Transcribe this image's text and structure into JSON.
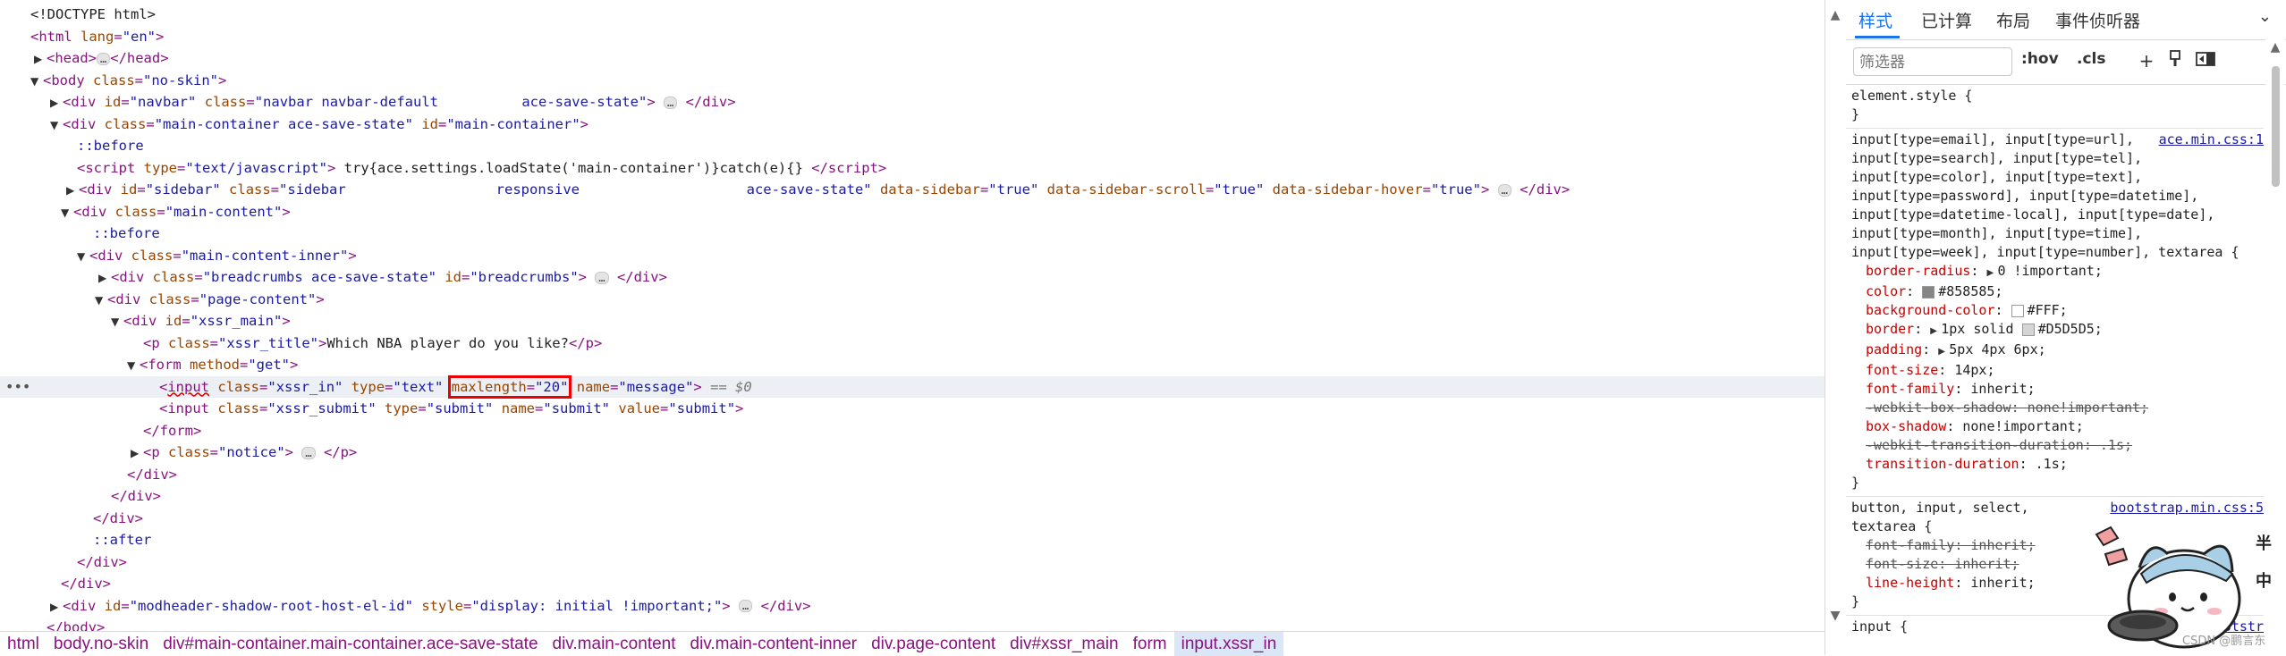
{
  "tree": {
    "doctype": "<!DOCTYPE html>",
    "html_open": [
      "html",
      "lang",
      "\"en\""
    ],
    "head": "head",
    "body_class": "\"no-skin\"",
    "navbar_id": "\"navbar\"",
    "navbar_class": "\"navbar navbar-default          ace-save-state\"",
    "main_container_class": "\"main-container ace-save-state\"",
    "main_container_id": "\"main-container\"",
    "before": "::before",
    "after": "::after",
    "script_type": "\"text/javascript\"",
    "script_text": "try{ace.settings.loadState('main-container')}catch(e){}",
    "sidebar_id": "\"sidebar\"",
    "sidebar_class": "\"sidebar                  responsive                    ace-save-state\"",
    "sidebar_data_sidebar": "\"true\"",
    "sidebar_data_scroll": "\"true\"",
    "sidebar_data_hover": "\"true\"",
    "main_content_class": "\"main-content\"",
    "main_content_inner_class": "\"main-content-inner\"",
    "breadcrumbs_class": "\"breadcrumbs ace-save-state\"",
    "breadcrumbs_id": "\"breadcrumbs\"",
    "page_content_class": "\"page-content\"",
    "xssr_main_id": "\"xssr_main\"",
    "p_title_class": "\"xssr_title\"",
    "p_title_text": "Which NBA player do you like?",
    "form_method": "\"get\"",
    "input1_class": "\"xssr_in\"",
    "input1_type": "\"text\"",
    "input1_maxlength": "\"20\"",
    "input1_name": "\"message\"",
    "eq0": "== $0",
    "input2_class": "\"xssr_submit\"",
    "input2_type": "\"submit\"",
    "input2_name": "\"submit\"",
    "input2_value": "\"submit\"",
    "notice_class": "\"notice\"",
    "modheader_id": "\"modheader-shadow-root-host-el-id\"",
    "modheader_style": "\"display: initial !important;\"",
    "ellipsis": "…"
  },
  "breadcrumbs": [
    "html",
    "body.no-skin",
    "div#main-container.main-container.ace-save-state",
    "div.main-content",
    "div.main-content-inner",
    "div.page-content",
    "div#xssr_main",
    "form",
    "input.xssr_in"
  ],
  "panel": {
    "tabs": [
      "样式",
      "已计算",
      "布局",
      "事件侦听器"
    ],
    "filter_placeholder": "筛选器",
    "hov": ":hov",
    "cls": ".cls",
    "element_style": "element.style {",
    "rule1_selector": [
      "input[type=email], input[type=url],",
      "input[type=search], input[type=tel],",
      "input[type=color], input[type=text],",
      "input[type=password], input[type=datetime],",
      "input[type=datetime-local], input[type=date],",
      "input[type=month], input[type=time],",
      "input[type=week], input[type=number], textarea {"
    ],
    "rule1_source": "ace.min.css:1",
    "rule1_props": [
      {
        "n": "border-radius",
        "v": "0 !important;",
        "tri": true
      },
      {
        "n": "color",
        "v": "#858585;",
        "swatch": "#858585"
      },
      {
        "n": "background-color",
        "v": "#FFF;",
        "swatch": "#ffffff"
      },
      {
        "n": "border",
        "v": "1px solid ",
        "v2": "#D5D5D5;",
        "tri": true,
        "swatch": "#d5d5d5"
      },
      {
        "n": "padding",
        "v": "5px 4px 6px;",
        "tri": true
      },
      {
        "n": "font-size",
        "v": "14px;"
      },
      {
        "n": "font-family",
        "v": "inherit;"
      },
      {
        "n": "-webkit-box-shadow",
        "v": "none!important;",
        "strike": true
      },
      {
        "n": "box-shadow",
        "v": "none!important;"
      },
      {
        "n": "-webkit-transition-duration",
        "v": ".1s;",
        "strike": true
      },
      {
        "n": "transition-duration",
        "v": ".1s;"
      }
    ],
    "rule2_selector": [
      "button, input, select,",
      "textarea {"
    ],
    "rule2_source": "bootstrap.min.css:5",
    "rule2_props": [
      {
        "n": "font-family",
        "v": "inherit;",
        "strike": true
      },
      {
        "n": "font-size",
        "v": "inherit;",
        "strike": true
      },
      {
        "n": "line-height",
        "v": "inherit;"
      }
    ],
    "rule3_selector": "input {",
    "rule3_source": "bootstr",
    "close_brace": "}",
    "watermark": "CSDN @鹏言东"
  },
  "mascot_text": [
    "半",
    "中"
  ]
}
